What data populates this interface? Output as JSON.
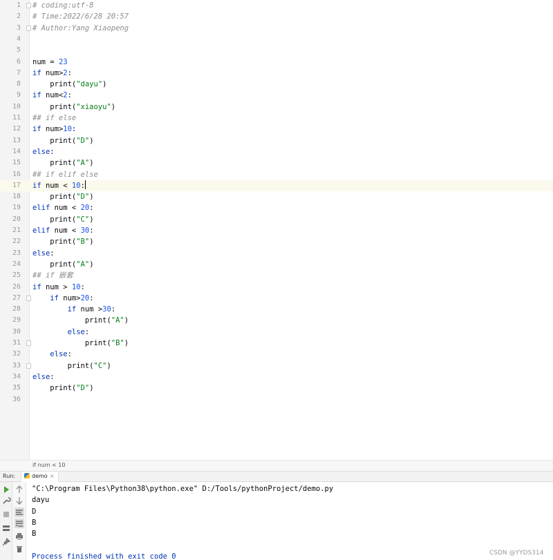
{
  "editor": {
    "caret_line": 17,
    "lines": [
      {
        "n": "1",
        "fold": true,
        "tokens": [
          {
            "c": "cmt",
            "t": "# coding:utf-8"
          }
        ]
      },
      {
        "n": "2",
        "tokens": [
          {
            "c": "cmt",
            "t": "# Time:2022/6/28 20:57"
          }
        ]
      },
      {
        "n": "3",
        "fold": true,
        "tokens": [
          {
            "c": "cmt",
            "t": "# Author:Yang Xiaopeng"
          }
        ]
      },
      {
        "n": "4",
        "tokens": []
      },
      {
        "n": "5",
        "tokens": []
      },
      {
        "n": "6",
        "tokens": [
          {
            "c": "plain",
            "t": "num = "
          },
          {
            "c": "num",
            "t": "23"
          }
        ]
      },
      {
        "n": "7",
        "tokens": [
          {
            "c": "kw",
            "t": "if"
          },
          {
            "c": "plain",
            "t": " num>"
          },
          {
            "c": "num",
            "t": "2"
          },
          {
            "c": "plain",
            "t": ":"
          }
        ]
      },
      {
        "n": "8",
        "tokens": [
          {
            "c": "plain",
            "t": "    print("
          },
          {
            "c": "str",
            "t": "\"dayu\""
          },
          {
            "c": "plain",
            "t": ")"
          }
        ]
      },
      {
        "n": "9",
        "tokens": [
          {
            "c": "kw",
            "t": "if"
          },
          {
            "c": "plain",
            "t": " num<"
          },
          {
            "c": "num",
            "t": "2"
          },
          {
            "c": "plain",
            "t": ":"
          }
        ]
      },
      {
        "n": "10",
        "tokens": [
          {
            "c": "plain",
            "t": "    print("
          },
          {
            "c": "str",
            "t": "\"xiaoyu\""
          },
          {
            "c": "plain",
            "t": ")"
          }
        ]
      },
      {
        "n": "11",
        "tokens": [
          {
            "c": "cmt",
            "t": "## if else"
          }
        ]
      },
      {
        "n": "12",
        "tokens": [
          {
            "c": "kw",
            "t": "if"
          },
          {
            "c": "plain",
            "t": " num>"
          },
          {
            "c": "num",
            "t": "10"
          },
          {
            "c": "plain",
            "t": ":"
          }
        ]
      },
      {
        "n": "13",
        "tokens": [
          {
            "c": "plain",
            "t": "    print("
          },
          {
            "c": "str",
            "t": "\"D\""
          },
          {
            "c": "plain",
            "t": ")"
          }
        ]
      },
      {
        "n": "14",
        "tokens": [
          {
            "c": "kw",
            "t": "else"
          },
          {
            "c": "plain",
            "t": ":"
          }
        ]
      },
      {
        "n": "15",
        "tokens": [
          {
            "c": "plain",
            "t": "    print("
          },
          {
            "c": "str",
            "t": "\"A\""
          },
          {
            "c": "plain",
            "t": ")"
          }
        ]
      },
      {
        "n": "16",
        "tokens": [
          {
            "c": "cmt",
            "t": "## if elif else"
          }
        ]
      },
      {
        "n": "17",
        "caret": true,
        "tokens": [
          {
            "c": "kw",
            "t": "if"
          },
          {
            "c": "plain",
            "t": " num < "
          },
          {
            "c": "num",
            "t": "10"
          },
          {
            "c": "plain",
            "t": ":"
          }
        ]
      },
      {
        "n": "18",
        "tokens": [
          {
            "c": "plain",
            "t": "    print("
          },
          {
            "c": "str",
            "t": "\"D\""
          },
          {
            "c": "plain",
            "t": ")"
          }
        ]
      },
      {
        "n": "19",
        "tokens": [
          {
            "c": "kw",
            "t": "elif"
          },
          {
            "c": "plain",
            "t": " num < "
          },
          {
            "c": "num",
            "t": "20"
          },
          {
            "c": "plain",
            "t": ":"
          }
        ]
      },
      {
        "n": "20",
        "tokens": [
          {
            "c": "plain",
            "t": "    print("
          },
          {
            "c": "str",
            "t": "\"C\""
          },
          {
            "c": "plain",
            "t": ")"
          }
        ]
      },
      {
        "n": "21",
        "tokens": [
          {
            "c": "kw",
            "t": "elif"
          },
          {
            "c": "plain",
            "t": " num < "
          },
          {
            "c": "num",
            "t": "30"
          },
          {
            "c": "plain",
            "t": ":"
          }
        ]
      },
      {
        "n": "22",
        "tokens": [
          {
            "c": "plain",
            "t": "    print("
          },
          {
            "c": "str",
            "t": "\"B\""
          },
          {
            "c": "plain",
            "t": ")"
          }
        ]
      },
      {
        "n": "23",
        "tokens": [
          {
            "c": "kw",
            "t": "else"
          },
          {
            "c": "plain",
            "t": ":"
          }
        ]
      },
      {
        "n": "24",
        "tokens": [
          {
            "c": "plain",
            "t": "    print("
          },
          {
            "c": "str",
            "t": "\"A\""
          },
          {
            "c": "plain",
            "t": ")"
          }
        ]
      },
      {
        "n": "25",
        "tokens": [
          {
            "c": "cmt",
            "t": "## if 嵌套"
          }
        ]
      },
      {
        "n": "26",
        "tokens": [
          {
            "c": "kw",
            "t": "if"
          },
          {
            "c": "plain",
            "t": " num > "
          },
          {
            "c": "num",
            "t": "10"
          },
          {
            "c": "plain",
            "t": ":"
          }
        ]
      },
      {
        "n": "27",
        "fold": true,
        "tokens": [
          {
            "c": "plain",
            "t": "    "
          },
          {
            "c": "kw",
            "t": "if"
          },
          {
            "c": "plain",
            "t": " num>"
          },
          {
            "c": "num",
            "t": "20"
          },
          {
            "c": "plain",
            "t": ":"
          }
        ]
      },
      {
        "n": "28",
        "tokens": [
          {
            "c": "plain",
            "t": "        "
          },
          {
            "c": "kw",
            "t": "if"
          },
          {
            "c": "plain",
            "t": " num >"
          },
          {
            "c": "num",
            "t": "30"
          },
          {
            "c": "plain",
            "t": ":"
          }
        ]
      },
      {
        "n": "29",
        "tokens": [
          {
            "c": "plain",
            "t": "            print("
          },
          {
            "c": "str",
            "t": "\"A\""
          },
          {
            "c": "plain",
            "t": ")"
          }
        ]
      },
      {
        "n": "30",
        "tokens": [
          {
            "c": "plain",
            "t": "        "
          },
          {
            "c": "kw",
            "t": "else"
          },
          {
            "c": "plain",
            "t": ":"
          }
        ]
      },
      {
        "n": "31",
        "fold": true,
        "tokens": [
          {
            "c": "plain",
            "t": "            print("
          },
          {
            "c": "str",
            "t": "\"B\""
          },
          {
            "c": "plain",
            "t": ")"
          }
        ]
      },
      {
        "n": "32",
        "tokens": [
          {
            "c": "plain",
            "t": "    "
          },
          {
            "c": "kw",
            "t": "else"
          },
          {
            "c": "plain",
            "t": ":"
          }
        ]
      },
      {
        "n": "33",
        "fold": true,
        "tokens": [
          {
            "c": "plain",
            "t": "        print("
          },
          {
            "c": "str",
            "t": "\"C\""
          },
          {
            "c": "plain",
            "t": ")"
          }
        ]
      },
      {
        "n": "34",
        "tokens": [
          {
            "c": "kw",
            "t": "else"
          },
          {
            "c": "plain",
            "t": ":"
          }
        ]
      },
      {
        "n": "35",
        "tokens": [
          {
            "c": "plain",
            "t": "    print("
          },
          {
            "c": "str",
            "t": "\"D\""
          },
          {
            "c": "plain",
            "t": ")"
          }
        ]
      },
      {
        "n": "36",
        "tokens": []
      }
    ]
  },
  "breadcrumb": {
    "text": "if num < 10"
  },
  "run": {
    "label": "Run:",
    "tab_label": "demo",
    "tab_close": "×",
    "toolbar_icons": [
      "run-icon",
      "up-icon",
      "wrench-icon",
      "down-icon",
      "stop-icon",
      "soft-wrap-icon",
      "scroll-to-end-icon",
      "layout-icon",
      "print-icon",
      "pin-icon",
      "trash-icon"
    ],
    "output": [
      {
        "kind": "cmd",
        "text": "\"C:\\Program Files\\Python38\\python.exe\" D:/Tools/pythonProject/demo.py"
      },
      {
        "kind": "out",
        "text": "dayu"
      },
      {
        "kind": "out",
        "text": "D"
      },
      {
        "kind": "out",
        "text": "B"
      },
      {
        "kind": "out",
        "text": "B"
      },
      {
        "kind": "out",
        "text": ""
      },
      {
        "kind": "exit",
        "text": "Process finished with exit code 0"
      }
    ]
  },
  "watermark": "CSDN @YYDS314",
  "colors": {
    "keyword": "#0033b3",
    "number": "#1750eb",
    "string": "#067d17",
    "comment": "#8c8c8c",
    "caret_row": "#fcfaed"
  }
}
